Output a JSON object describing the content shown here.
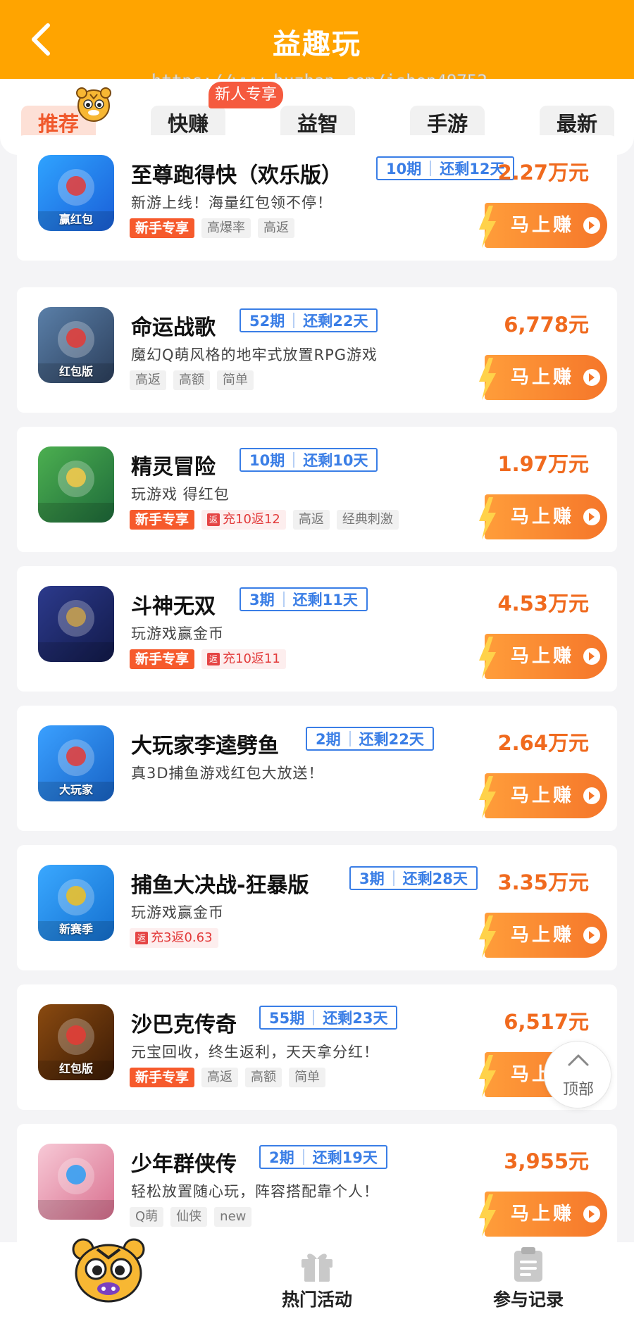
{
  "header": {
    "title": "益趣玩",
    "watermark": "https://www.huzhan.com/ishop49752"
  },
  "tabs": [
    {
      "label": "推荐",
      "active": true
    },
    {
      "label": "快赚",
      "active": false
    },
    {
      "label": "益智",
      "active": false
    },
    {
      "label": "手游",
      "active": false
    },
    {
      "label": "最新",
      "active": false
    }
  ],
  "new_user_badge": "新人专享",
  "earn_button_label": "马上赚",
  "games": [
    {
      "name": "至尊跑得快（欢乐版）",
      "period": "10期",
      "remaining": "还剩12天",
      "reward": "2.27万元",
      "desc": "新游上线！海量红包领不停！",
      "icon_caption": "赢红包",
      "tags": [
        {
          "text": "新手专享",
          "type": "newbie"
        },
        {
          "text": "高爆率",
          "type": "plain"
        },
        {
          "text": "高返",
          "type": "plain"
        }
      ]
    },
    {
      "name": "命运战歌",
      "period": "52期",
      "remaining": "还剩22天",
      "reward": "6,778元",
      "desc": "魔幻Q萌风格的地牢式放置RPG游戏",
      "icon_caption": "红包版",
      "tags": [
        {
          "text": "高返",
          "type": "plain"
        },
        {
          "text": "高额",
          "type": "plain"
        },
        {
          "text": "简单",
          "type": "plain"
        }
      ]
    },
    {
      "name": "精灵冒险",
      "period": "10期",
      "remaining": "还剩10天",
      "reward": "1.97万元",
      "desc": "玩游戏 得红包",
      "icon_caption": "",
      "tags": [
        {
          "text": "新手专享",
          "type": "newbie"
        },
        {
          "text": "充10返12",
          "type": "rebate"
        },
        {
          "text": "高返",
          "type": "plain"
        },
        {
          "text": "经典刺激",
          "type": "plain"
        }
      ]
    },
    {
      "name": "斗神无双",
      "period": "3期",
      "remaining": "还剩11天",
      "reward": "4.53万元",
      "desc": "玩游戏赢金币",
      "icon_caption": "",
      "tags": [
        {
          "text": "新手专享",
          "type": "newbie"
        },
        {
          "text": "充10返11",
          "type": "rebate"
        }
      ]
    },
    {
      "name": "大玩家李逵劈鱼",
      "period": "2期",
      "remaining": "还剩22天",
      "reward": "2.64万元",
      "desc": "真3D捕鱼游戏红包大放送！",
      "icon_caption": "大玩家",
      "tags": []
    },
    {
      "name": "捕鱼大决战-狂暴版",
      "period": "3期",
      "remaining": "还剩28天",
      "reward": "3.35万元",
      "desc": "玩游戏赢金币",
      "icon_caption": "新赛季",
      "tags": [
        {
          "text": "充3返0.63",
          "type": "rebate"
        }
      ]
    },
    {
      "name": "沙巴克传奇",
      "period": "55期",
      "remaining": "还剩23天",
      "reward": "6,517元",
      "desc": "元宝回收，终生返利，天天拿分红！",
      "icon_caption": "红包版",
      "tags": [
        {
          "text": "新手专享",
          "type": "newbie"
        },
        {
          "text": "高返",
          "type": "plain"
        },
        {
          "text": "高额",
          "type": "plain"
        },
        {
          "text": "简单",
          "type": "plain"
        }
      ]
    },
    {
      "name": "少年群侠传",
      "period": "2期",
      "remaining": "还剩19天",
      "reward": "3,955元",
      "desc": "轻松放置随心玩，阵容搭配靠个人！",
      "icon_caption": "",
      "tags": [
        {
          "text": "Q萌",
          "type": "plain"
        },
        {
          "text": "仙侠",
          "type": "plain"
        },
        {
          "text": "new",
          "type": "plain"
        }
      ]
    }
  ],
  "back_to_top": "顶部",
  "rebate_mark": "返",
  "bottom_nav": [
    {
      "label": "",
      "icon": "tiger-mascot-icon"
    },
    {
      "label": "热门活动",
      "icon": "gift-icon"
    },
    {
      "label": "参与记录",
      "icon": "clipboard-icon"
    }
  ],
  "colors": {
    "header": "#ffa400",
    "accent": "#f06a1e",
    "period_blue": "#3a7ee6",
    "newbie_tag": "#f65a2c"
  }
}
